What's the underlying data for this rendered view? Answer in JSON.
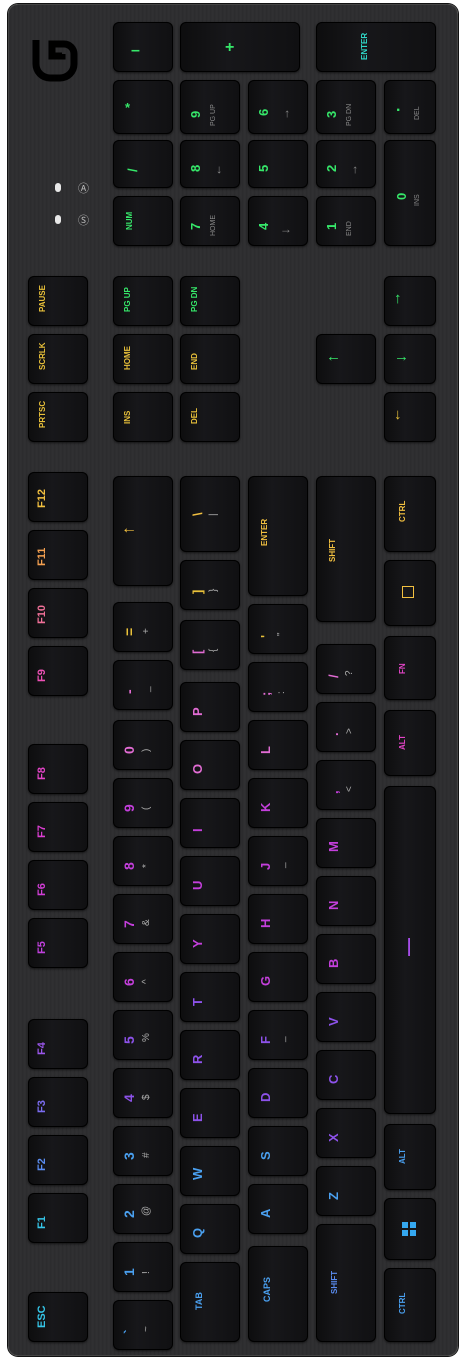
{
  "brand_icon": "logitech-g-logo",
  "indicators": {
    "caps_lock_icon": "caps-lock-indicator",
    "scroll_lock_icon": "scroll-lock-indicator"
  },
  "numpad": {
    "minus": "–",
    "plus": "+",
    "enter": "ENTER",
    "asterisk": "*",
    "k9": "9",
    "k9_sub": "PG UP",
    "k6": "6",
    "k6_sub": "→",
    "k3": "3",
    "k3_sub": "PG DN",
    "dot": ".",
    "dot_sub": "DEL",
    "slash": "/",
    "k8": "8",
    "k8_sub": "←",
    "k5": "5",
    "k2": "2",
    "k2_sub": "→",
    "k0": "0",
    "k0_sub": "INS",
    "num": "NUM",
    "k7": "7",
    "k7_sub": "HOME",
    "k4": "4",
    "k4_sub": "↓",
    "k1": "1",
    "k1_sub": "END"
  },
  "nav": {
    "pause": "PAUSE",
    "scrlk": "SCRLK",
    "prtsc": "PRTSC",
    "pgup": "PG UP",
    "pgdn": "PG DN",
    "home": "HOME",
    "end": "END",
    "ins": "INS",
    "del": "DEL"
  },
  "arrows": {
    "up": "↑",
    "left": "←",
    "down": "↓",
    "right": "→"
  },
  "fkeys": [
    "ESC",
    "F1",
    "F2",
    "F3",
    "F4",
    "F5",
    "F6",
    "F7",
    "F8",
    "F9",
    "F10",
    "F11",
    "F12"
  ],
  "fkey_icons": [
    "",
    "",
    "",
    "",
    "",
    "settings-icon",
    "window-icon",
    "stop-icon",
    "record-icon",
    "media-icon",
    "minus-icon",
    "media-icon",
    "media-icon"
  ],
  "row_num": [
    {
      "main": "`",
      "sub": "~"
    },
    {
      "main": "1",
      "sub": "!"
    },
    {
      "main": "2",
      "sub": "@"
    },
    {
      "main": "3",
      "sub": "#"
    },
    {
      "main": "4",
      "sub": "$"
    },
    {
      "main": "5",
      "sub": "%"
    },
    {
      "main": "6",
      "sub": "^"
    },
    {
      "main": "7",
      "sub": "&"
    },
    {
      "main": "8",
      "sub": "*"
    },
    {
      "main": "9",
      "sub": "("
    },
    {
      "main": "0",
      "sub": ")"
    },
    {
      "main": "-",
      "sub": "_"
    },
    {
      "main": "=",
      "sub": "+"
    },
    {
      "main": "←",
      "sub": ""
    }
  ],
  "row_tab": [
    {
      "main": "TAB",
      "sub": ""
    },
    {
      "main": "Q",
      "sub": ""
    },
    {
      "main": "W",
      "sub": ""
    },
    {
      "main": "E",
      "sub": ""
    },
    {
      "main": "R",
      "sub": ""
    },
    {
      "main": "T",
      "sub": ""
    },
    {
      "main": "Y",
      "sub": ""
    },
    {
      "main": "U",
      "sub": ""
    },
    {
      "main": "I",
      "sub": ""
    },
    {
      "main": "O",
      "sub": ""
    },
    {
      "main": "P",
      "sub": ""
    },
    {
      "main": "[",
      "sub": "{"
    },
    {
      "main": "]",
      "sub": "}"
    },
    {
      "main": "\\",
      "sub": "|"
    }
  ],
  "row_caps": [
    {
      "main": "CAPS",
      "sub": ""
    },
    {
      "main": "A",
      "sub": ""
    },
    {
      "main": "S",
      "sub": ""
    },
    {
      "main": "D",
      "sub": ""
    },
    {
      "main": "F",
      "sub": "_"
    },
    {
      "main": "G",
      "sub": ""
    },
    {
      "main": "H",
      "sub": ""
    },
    {
      "main": "J",
      "sub": "_"
    },
    {
      "main": "K",
      "sub": ""
    },
    {
      "main": "L",
      "sub": ""
    },
    {
      "main": ";",
      "sub": ":"
    },
    {
      "main": "'",
      "sub": "\""
    },
    {
      "main": "ENTER",
      "sub": ""
    }
  ],
  "row_shift": [
    {
      "main": "SHIFT",
      "sub": ""
    },
    {
      "main": "Z",
      "sub": ""
    },
    {
      "main": "X",
      "sub": ""
    },
    {
      "main": "C",
      "sub": ""
    },
    {
      "main": "V",
      "sub": ""
    },
    {
      "main": "B",
      "sub": ""
    },
    {
      "main": "N",
      "sub": ""
    },
    {
      "main": "M",
      "sub": ""
    },
    {
      "main": ",",
      "sub": "<"
    },
    {
      "main": ".",
      "sub": ">"
    },
    {
      "main": "/",
      "sub": "?"
    },
    {
      "main": "SHIFT",
      "sub": ""
    }
  ],
  "row_bottom": [
    {
      "main": "CTRL",
      "sub": "",
      "icon": ""
    },
    {
      "main": "",
      "sub": "",
      "icon": "windows-icon"
    },
    {
      "main": "ALT",
      "sub": "",
      "icon": ""
    },
    {
      "main": "—",
      "sub": "",
      "icon": ""
    },
    {
      "main": "ALT",
      "sub": "",
      "icon": ""
    },
    {
      "main": "FN",
      "sub": "",
      "icon": ""
    },
    {
      "main": "",
      "sub": "",
      "icon": "menu-icon"
    },
    {
      "main": "CTRL",
      "sub": "",
      "icon": ""
    }
  ]
}
